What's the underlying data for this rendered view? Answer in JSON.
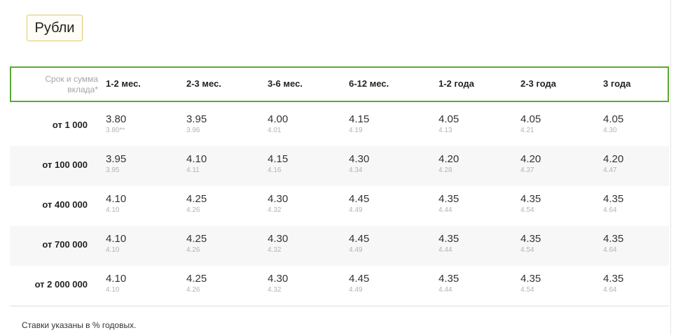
{
  "currency_tab": {
    "label": "Рубли"
  },
  "table": {
    "corner_label_line1": "Срок и сумма",
    "corner_label_line2": "вклада*",
    "columns": [
      "1-2 мес.",
      "2-3 мес.",
      "3-6 мес.",
      "6-12 мес.",
      "1-2 года",
      "2-3 года",
      "3 года"
    ],
    "rows": [
      {
        "label": "от 1 000",
        "main": [
          "3.80",
          "3.95",
          "4.00",
          "4.15",
          "4.05",
          "4.05",
          "4.05"
        ],
        "sub": [
          "3.80**",
          "3.96",
          "4.01",
          "4.19",
          "4.13",
          "4.21",
          "4.30"
        ]
      },
      {
        "label": "от 100 000",
        "main": [
          "3.95",
          "4.10",
          "4.15",
          "4.30",
          "4.20",
          "4.20",
          "4.20"
        ],
        "sub": [
          "3.95",
          "4.11",
          "4.16",
          "4.34",
          "4.28",
          "4.37",
          "4.47"
        ]
      },
      {
        "label": "от 400 000",
        "main": [
          "4.10",
          "4.25",
          "4.30",
          "4.45",
          "4.35",
          "4.35",
          "4.35"
        ],
        "sub": [
          "4.10",
          "4.26",
          "4.32",
          "4.49",
          "4.44",
          "4.54",
          "4.64"
        ]
      },
      {
        "label": "от 700 000",
        "main": [
          "4.10",
          "4.25",
          "4.30",
          "4.45",
          "4.35",
          "4.35",
          "4.35"
        ],
        "sub": [
          "4.10",
          "4.26",
          "4.32",
          "4.49",
          "4.44",
          "4.54",
          "4.64"
        ]
      },
      {
        "label": "от 2 000 000",
        "main": [
          "4.10",
          "4.25",
          "4.30",
          "4.45",
          "4.35",
          "4.35",
          "4.35"
        ],
        "sub": [
          "4.10",
          "4.26",
          "4.32",
          "4.49",
          "4.44",
          "4.54",
          "4.64"
        ]
      }
    ]
  },
  "footnote": "Ставки указаны в % годовых.",
  "colors": {
    "header_border": "#5aaa32",
    "tab_border": "#e2c86a",
    "alt_row": "#f7f7f7"
  }
}
